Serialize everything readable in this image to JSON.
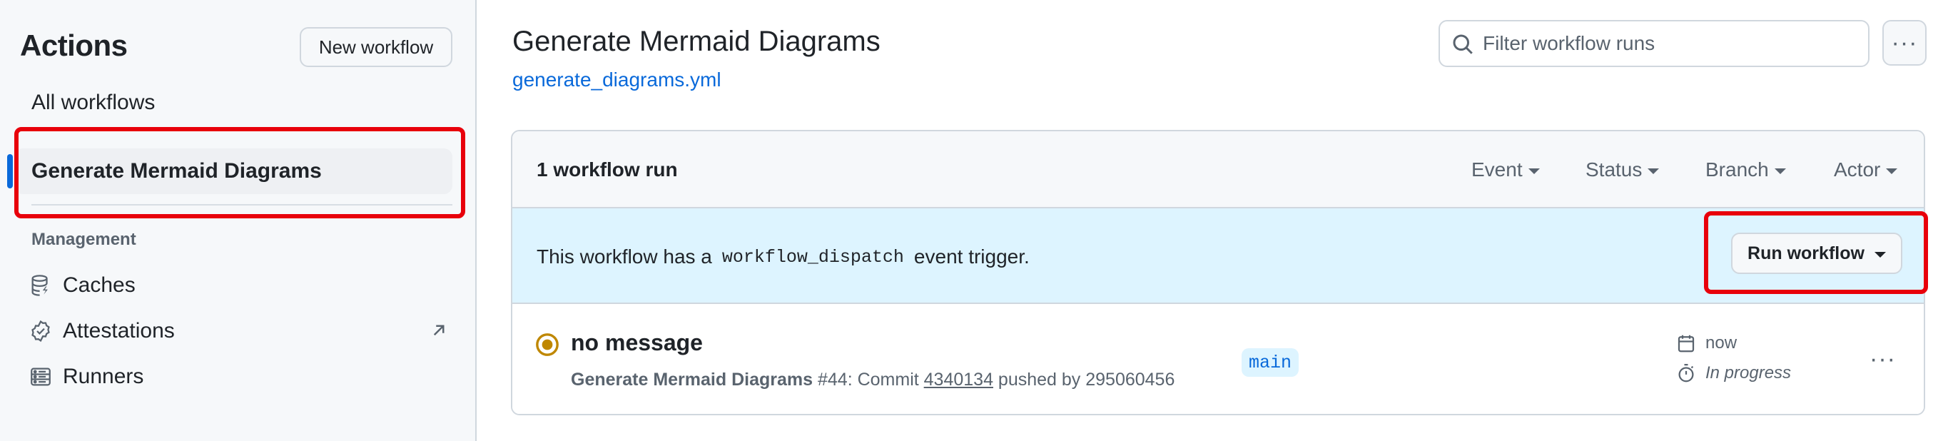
{
  "sidebar": {
    "title": "Actions",
    "new_workflow_label": "New workflow",
    "all_workflows_label": "All workflows",
    "active_workflow_label": "Generate Mermaid Diagrams",
    "section_label": "Management",
    "items": [
      {
        "label": "Caches",
        "icon": "database-icon"
      },
      {
        "label": "Attestations",
        "icon": "verified-icon"
      },
      {
        "label": "Runners",
        "icon": "server-icon"
      }
    ]
  },
  "main": {
    "title": "Generate Mermaid Diagrams",
    "file_link": "generate_diagrams.yml",
    "filter_placeholder": "Filter workflow runs",
    "more_label": "···"
  },
  "runs": {
    "count_label": "1 workflow run",
    "filters": [
      "Event",
      "Status",
      "Branch",
      "Actor"
    ],
    "banner_prefix": "This workflow has a",
    "banner_code": "workflow_dispatch",
    "banner_suffix": "event trigger.",
    "run_workflow_label": "Run workflow",
    "items": [
      {
        "title": "no message",
        "workflow_name": "Generate Mermaid Diagrams",
        "meta_mid": " #44: Commit ",
        "commit": "4340134",
        "meta_end": " pushed by 295060456",
        "branch": "main",
        "time": "now",
        "status": "In progress",
        "more_label": "···"
      }
    ]
  },
  "colors": {
    "accent": "#0969da",
    "highlight": "#e8000b",
    "banner_bg": "#ddf4ff",
    "in_progress": "#bf8700"
  }
}
